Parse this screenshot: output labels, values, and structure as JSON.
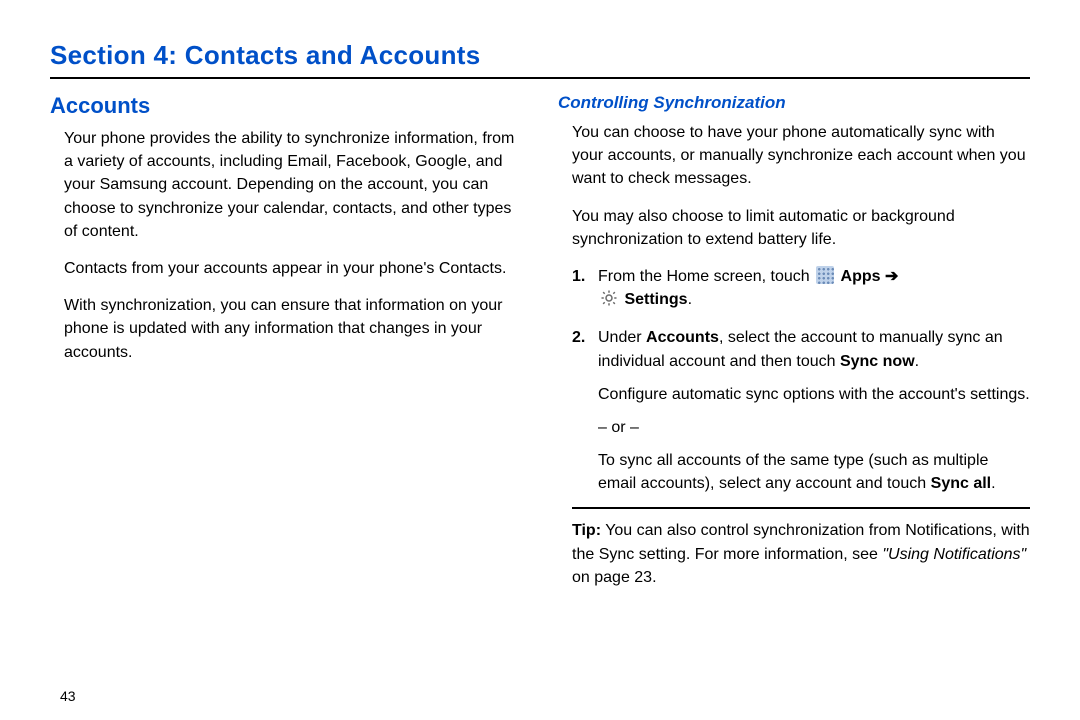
{
  "section_title": "Section 4: Contacts and Accounts",
  "page_number": "43",
  "left": {
    "heading": "Accounts",
    "p1": "Your phone provides the ability to synchronize information, from a variety of accounts, including Email, Facebook, Google, and your Samsung account. Depending on the account, you can choose to synchronize your calendar, contacts, and other types of content.",
    "p2": "Contacts from your accounts appear in your phone's Contacts.",
    "p3": "With synchronization, you can ensure that information on your phone is updated with any information that changes in your accounts."
  },
  "right": {
    "heading": "Controlling Synchronization",
    "p1": "You can choose to have your phone automatically sync with your accounts, or manually synchronize each account when you want to check messages.",
    "p2": "You may also choose to limit automatic or background synchronization to extend battery life.",
    "step1_prefix": "From the Home screen, touch ",
    "step1_apps": "Apps",
    "step1_arrow": " ➔ ",
    "step1_settings": "Settings",
    "step1_suffix": ".",
    "step2_a": "Under ",
    "step2_accounts": "Accounts",
    "step2_b": ", select the account to manually sync an individual account and then touch ",
    "step2_syncnow": "Sync now",
    "step2_c": ".",
    "step2_d": "Configure automatic sync options with the account's settings.",
    "or": "– or –",
    "step2_e1": "To sync all accounts of the same type (such as multiple email accounts), select any account and touch ",
    "step2_syncall": "Sync all",
    "step2_e2": ".",
    "tip_label": "Tip:",
    "tip_a": " You can also control synchronization from Notifications, with the Sync setting. For more information, see ",
    "tip_ref": "\"Using Notifications\"",
    "tip_b": " on page 23."
  },
  "nums": {
    "one": "1.",
    "two": "2."
  }
}
